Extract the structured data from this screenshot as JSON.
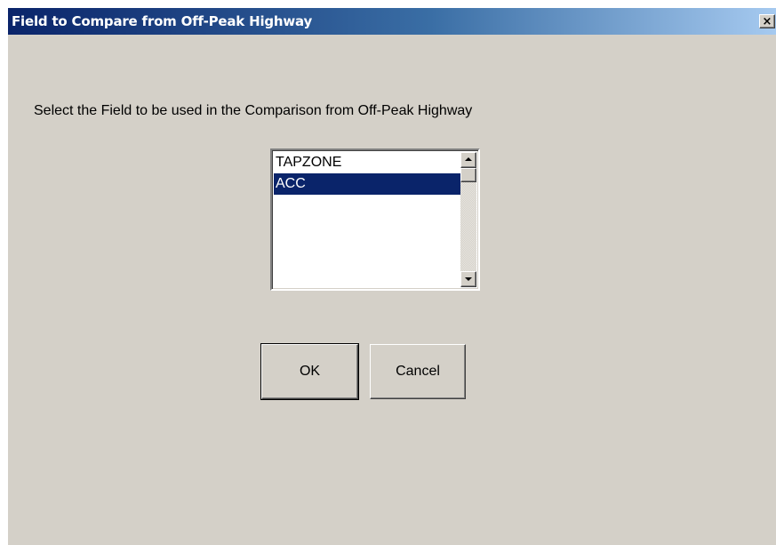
{
  "window": {
    "title": "Field to Compare from Off-Peak Highway",
    "close_glyph": "×"
  },
  "dialog": {
    "prompt": "Select the Field to be used in the Comparison from Off-Peak Highway",
    "field_list": {
      "items": [
        "TAPZONE",
        "ACC"
      ],
      "selected": "ACC"
    },
    "buttons": {
      "ok_label": "OK",
      "cancel_label": "Cancel"
    }
  },
  "colors": {
    "titlebar_start": "#0a246a",
    "titlebar_end": "#a6caf0",
    "dialog_face": "#d4d0c8",
    "selection": "#0a246a"
  }
}
